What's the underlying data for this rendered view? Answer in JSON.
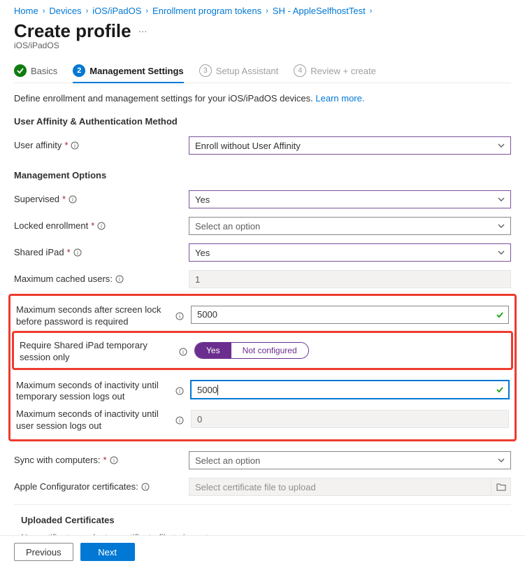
{
  "breadcrumb": [
    "Home",
    "Devices",
    "iOS/iPadOS",
    "Enrollment program tokens",
    "SH - AppleSelfhostTest"
  ],
  "title": "Create profile",
  "subtitle": "iOS/iPadOS",
  "tabs": {
    "basics": "Basics",
    "management": "Management Settings",
    "setup": "Setup Assistant",
    "review": "Review + create"
  },
  "desc_text": "Define enrollment and management settings for your iOS/iPadOS devices. ",
  "desc_link": "Learn more.",
  "sections": {
    "affinity_h": "User Affinity & Authentication Method",
    "mgmt_h": "Management Options"
  },
  "labels": {
    "user_affinity": "User affinity",
    "supervised": "Supervised",
    "locked": "Locked enrollment",
    "shared_ipad": "Shared iPad",
    "max_cached": "Maximum cached users:",
    "max_after_lock": "Maximum seconds after screen lock before password is required",
    "require_temp": "Require Shared iPad temporary session only",
    "max_inactive_temp": "Maximum seconds of inactivity until temporary session logs out",
    "max_inactive_user": "Maximum seconds of inactivity until user session logs out",
    "sync": "Sync with computers:",
    "configurator": "Apple Configurator certificates:",
    "uploaded_h": "Uploaded Certificates",
    "uploaded_empty": "No certificates, select a certificate file to import."
  },
  "values": {
    "user_affinity": "Enroll without User Affinity",
    "supervised": "Yes",
    "locked": "Select an option",
    "shared_ipad": "Yes",
    "max_cached": "1",
    "max_after_lock": "5000",
    "require_temp_yes": "Yes",
    "require_temp_no": "Not configured",
    "max_inactive_temp": "5000",
    "max_inactive_user": "0",
    "sync": "Select an option",
    "configurator_ph": "Select certificate file to upload"
  },
  "buttons": {
    "previous": "Previous",
    "next": "Next"
  },
  "step_numbers": {
    "n2": "2",
    "n3": "3",
    "n4": "4"
  }
}
